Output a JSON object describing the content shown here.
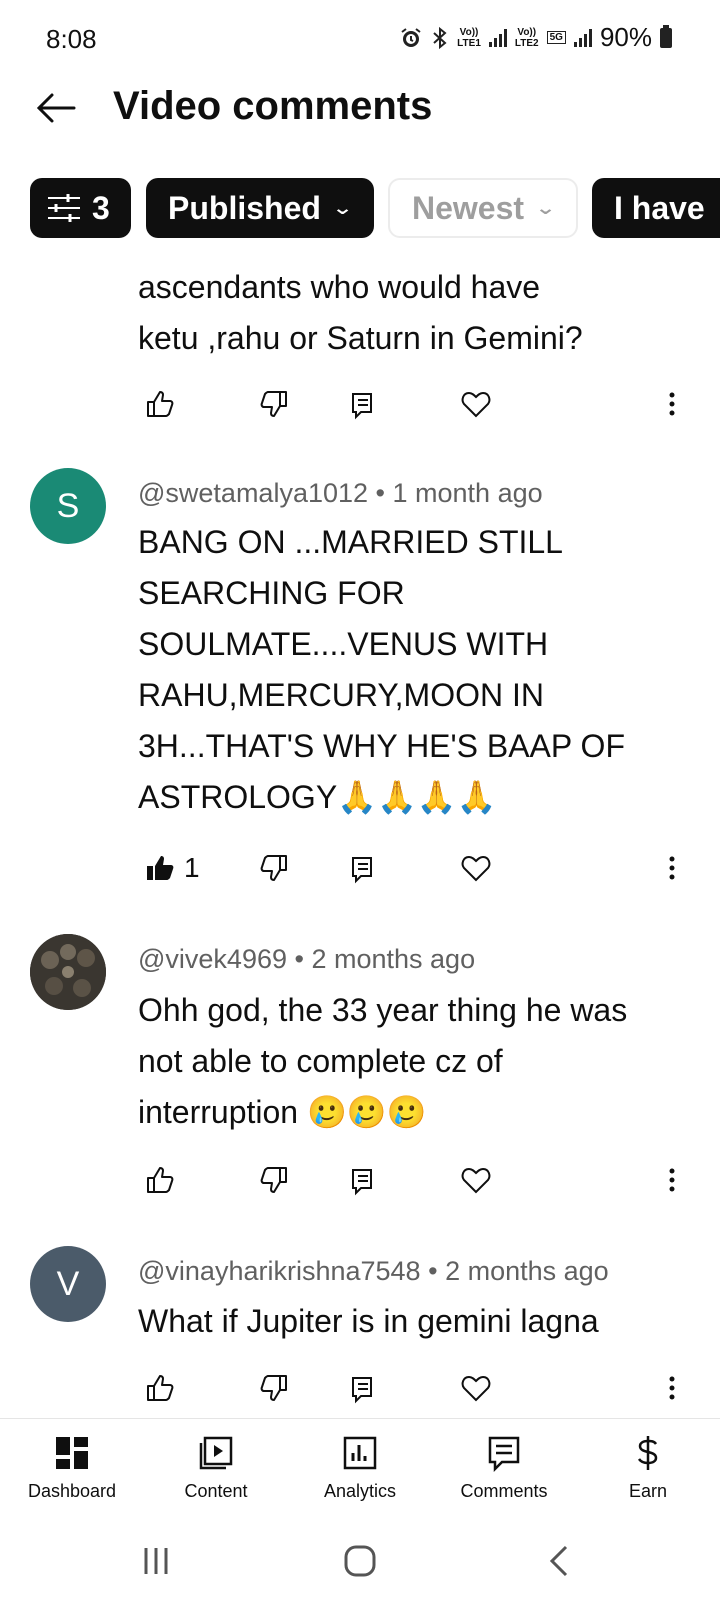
{
  "status_bar": {
    "time": "8:08",
    "net1_top": "Vo))",
    "net1_bottom": "LTE1",
    "net2_top": "Vo))",
    "net2_bottom": "LTE2",
    "net2_badge": "5G",
    "battery": "90%",
    "icons": [
      "alarm-icon",
      "bluetooth-icon",
      "signal-icon",
      "battery-icon"
    ]
  },
  "header": {
    "title": "Video comments"
  },
  "filters": {
    "filter_count": "3",
    "published_label": "Published",
    "sort_label": "Newest",
    "question_label": "I have"
  },
  "comments": [
    {
      "text_lines": [
        "ascendants who would have",
        "ketu ,rahu or Saturn in Gemini?"
      ]
    },
    {
      "avatar_letter": "S",
      "avatar_color": "#1a8a75",
      "author": "@swetamalya1012",
      "sep": "•",
      "time": "1 month ago",
      "text_lines": [
        "BANG ON ...MARRIED STILL",
        "SEARCHING FOR",
        "SOULMATE....VENUS WITH",
        "RAHU,MERCURY,MOON IN",
        "3H...THAT'S WHY HE'S BAAP OF",
        "ASTROLOGY🙏🙏🙏🙏"
      ],
      "likes": "1"
    },
    {
      "avatar_letter": "",
      "author": "@vivek4969",
      "sep": "•",
      "time": "2 months ago",
      "text_lines": [
        "Ohh god, the 33 year thing he was",
        "not able to complete cz of",
        "interruption 🥲🥲🥲"
      ]
    },
    {
      "avatar_letter": "V",
      "avatar_color": "#4b5b6a",
      "author": "@vinayharikrishna7548",
      "sep": "•",
      "time": "2 months ago",
      "text_lines": [
        "What if Jupiter is in gemini lagna"
      ]
    }
  ],
  "bottom_nav": {
    "items": [
      {
        "label": "Dashboard",
        "icon": "dashboard-icon"
      },
      {
        "label": "Content",
        "icon": "content-icon"
      },
      {
        "label": "Analytics",
        "icon": "analytics-icon"
      },
      {
        "label": "Comments",
        "icon": "comments-icon"
      },
      {
        "label": "Earn",
        "icon": "dollar-icon"
      }
    ]
  }
}
